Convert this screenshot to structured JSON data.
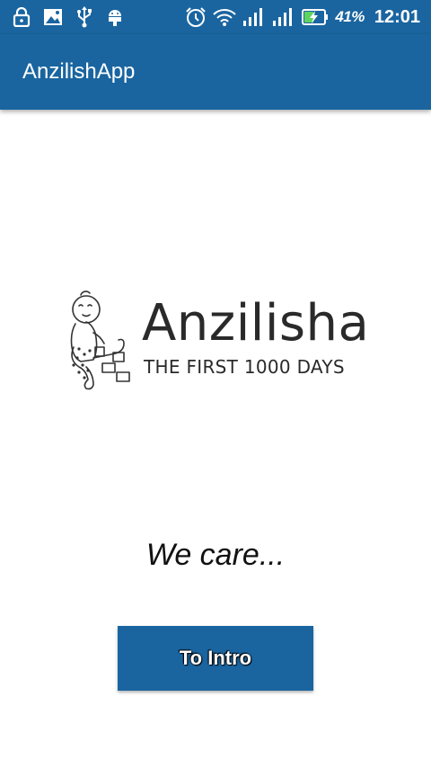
{
  "status_bar": {
    "left_icons": [
      "lock-icon",
      "image-icon",
      "usb-icon",
      "android-debug-icon"
    ],
    "right_icons": [
      "alarm-icon",
      "wifi-icon",
      "signal-icon",
      "signal-icon",
      "battery-charging-icon"
    ],
    "battery_percent": "41%",
    "time": "12:01"
  },
  "app_bar": {
    "title": "AnzilishApp"
  },
  "logo": {
    "name": "Anzilisha",
    "tagline": "THE FIRST 1000 DAYS"
  },
  "main": {
    "tagline": "We care...",
    "intro_button_label": "To Intro"
  },
  "colors": {
    "primary": "#1a65a0",
    "background": "#ffffff",
    "text": "#111111"
  }
}
